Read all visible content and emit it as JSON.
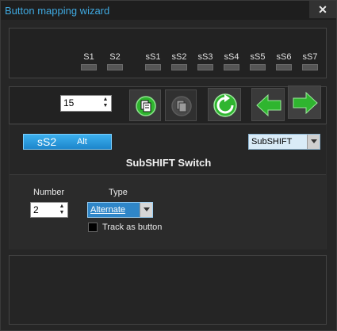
{
  "window": {
    "title": "Button mapping wizard",
    "close_glyph": "✕"
  },
  "shift_labels": [
    "S1",
    "S2",
    "sS1",
    "sS2",
    "sS3",
    "sS4",
    "sS5",
    "sS6",
    "sS7"
  ],
  "toolbar": {
    "number_value": "15",
    "icons": [
      "copy-icon",
      "paste-icon",
      "reset-icon",
      "arrow-left-icon",
      "arrow-right-icon"
    ]
  },
  "detail": {
    "name_main": "sS2",
    "name_sub": "Alt",
    "mode_select": "SubSHIFT",
    "heading": "SubSHIFT Switch",
    "number_label": "Number",
    "number_value": "2",
    "type_label": "Type",
    "type_value": "Alternate",
    "track_label": "Track as button"
  },
  "colors": {
    "accent": "#3fa9e0",
    "green": "#2fb52f",
    "panel": "#222222"
  }
}
